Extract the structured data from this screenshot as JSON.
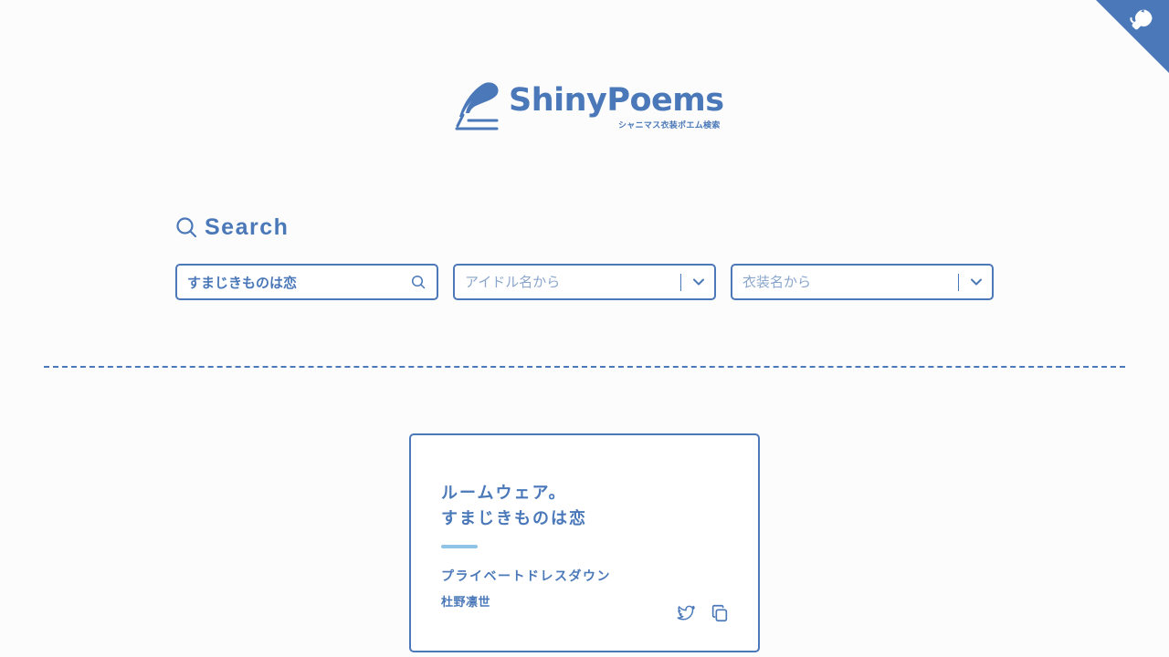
{
  "header": {
    "logo_title": "ShinyPoems",
    "logo_subtitle": "シャニマス衣装ポエム検索",
    "github_corner_icon": "github-octocat-icon"
  },
  "search": {
    "heading": "Search",
    "heading_icon": "search-icon",
    "text_value": "すまじきものは恋",
    "idol_placeholder": "アイドル名から",
    "costume_placeholder": "衣装名から"
  },
  "results": [
    {
      "poem_line1": "ルームウェア。",
      "poem_line2": "すまじきものは恋",
      "costume": "プライベートドレスダウン",
      "idol": "杜野凛世",
      "actions": [
        "twitter-icon",
        "copy-icon"
      ]
    }
  ],
  "colors": {
    "primary": "#4a78b8",
    "accent": "#8fc4e6",
    "placeholder": "#8aa6cc",
    "background": "#fcfcfc"
  }
}
